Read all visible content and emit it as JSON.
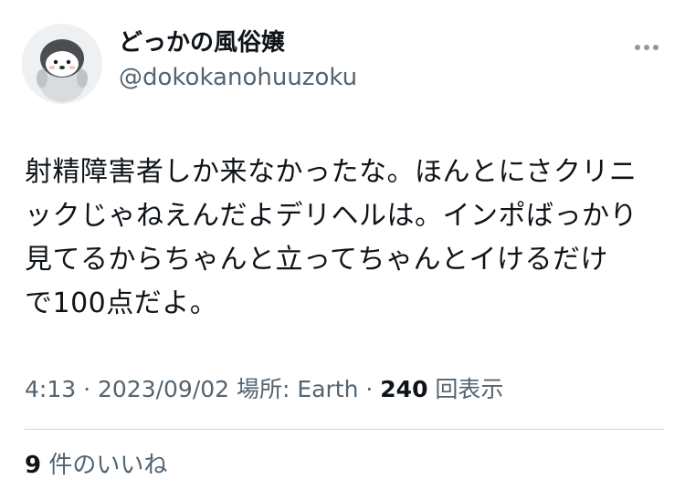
{
  "author": {
    "display_name": "どっかの風俗嬢",
    "handle": "@dokokanohuuzoku",
    "avatar_icon": "penguin-avatar-icon"
  },
  "more_icon": "more-options-icon",
  "tweet": {
    "lines": [
      "射精障害者しか来なかったな。ほんとにさクリニ",
      "ックじゃねえんだよデリヘルは。インポばっかり",
      "見てるからちゃんと立ってちゃんとイけるだけ",
      "で100点だよ。"
    ]
  },
  "meta": {
    "time": "4:13",
    "separator1": " · ",
    "date": "2023/09/02",
    "location_label": " 場所: Earth",
    "separator2": " · ",
    "views_count": "240",
    "views_label": " 回表示"
  },
  "likes": {
    "count": "9",
    "label": " 件のいいね"
  },
  "colors": {
    "text_primary": "#0f1419",
    "text_secondary": "#536471",
    "divider": "#cfd9de"
  }
}
